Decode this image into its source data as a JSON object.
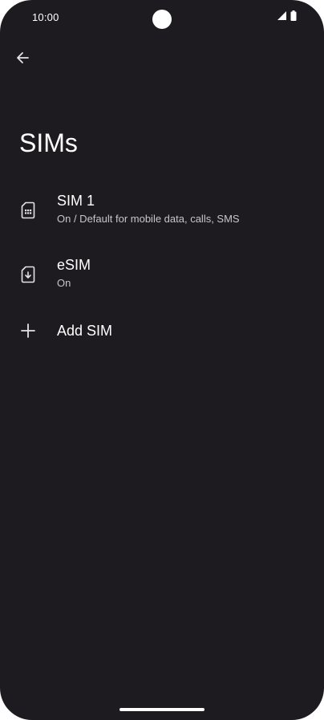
{
  "status_bar": {
    "time": "10:00",
    "icons": [
      "camera-cutout",
      "cellular-signal-icon",
      "battery-icon"
    ]
  },
  "app_bar": {
    "back_icon": "arrow-back-icon"
  },
  "page": {
    "title": "SIMs"
  },
  "sim_list": [
    {
      "icon": "sim-card-icon",
      "title": "SIM 1",
      "subtitle": "On / Default for mobile data, calls, SMS"
    },
    {
      "icon": "esim-download-icon",
      "title": "eSIM",
      "subtitle": "On"
    }
  ],
  "add_sim": {
    "icon": "plus-icon",
    "label": "Add SIM"
  },
  "colors": {
    "background": "#1e1b20",
    "text_primary": "#ffffff",
    "text_secondary": "#c9c4ca",
    "icon": "#e6e1e5"
  }
}
